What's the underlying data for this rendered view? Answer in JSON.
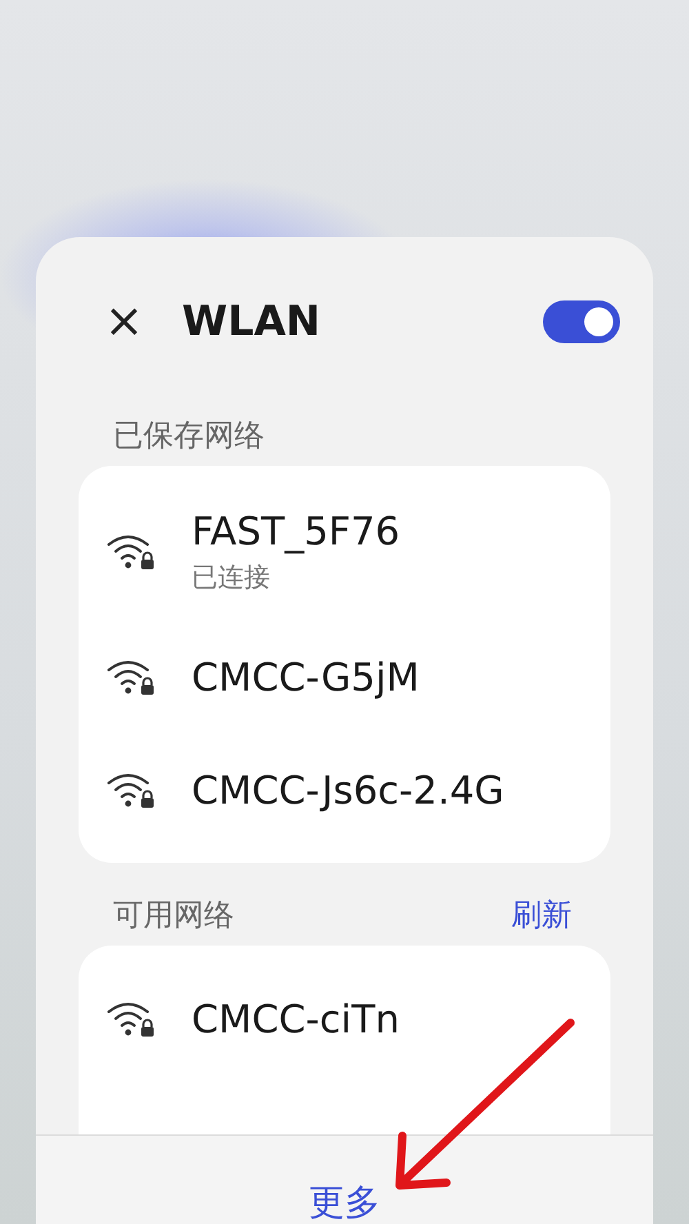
{
  "header": {
    "close": "×",
    "title": "WLAN",
    "wlan_on": true
  },
  "saved": {
    "label": "已保存网络",
    "networks": [
      {
        "name": "FAST_5F76",
        "status": "已连接",
        "locked": true
      },
      {
        "name": "CMCC-G5jM",
        "locked": true
      },
      {
        "name": "CMCC-Js6c-2.4G",
        "locked": true
      }
    ]
  },
  "available": {
    "label": "可用网络",
    "refresh": "刷新",
    "networks": [
      {
        "name": "CMCC-ciTn",
        "locked": true
      }
    ]
  },
  "more": "更多"
}
